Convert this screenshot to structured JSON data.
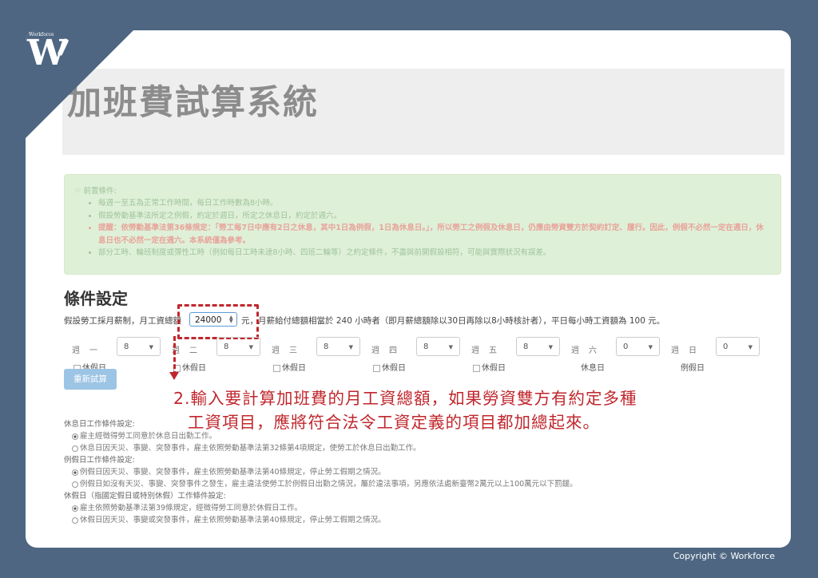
{
  "brand": {
    "logo_small": "Workforce",
    "logo_letter": "W"
  },
  "page_title": "加班費試算系統",
  "alert": {
    "heading": "前置條件:",
    "items": [
      {
        "text": "每週一至五為正常工作時間，每日工作時數為8小時。",
        "warn": false
      },
      {
        "text": "假設勞動基準法所定之例假，約定於週日，所定之休息日，約定於週六。",
        "warn": false
      },
      {
        "text": "提醒：依勞動基準法第36條規定：「勞工每7日中應有2日之休息，其中1日為例假，1日為休息日。」，所以勞工之例假及休息日，仍應由勞資雙方於契約訂定、履行。因此，例假不必然一定在週日，休息日也不必然一定在週六。本系統僅為參考。",
        "warn": true
      },
      {
        "text": "部分工時、輪班制度或彈性工時（例如每日工時未達8小時、四班二輪等）之約定條件，不盡與前開假設相符，可能與實際狀況有誤差。",
        "warn": false
      }
    ]
  },
  "conditions": {
    "title": "條件設定",
    "salary_prefix": "假設勞工採月薪制，月工資總額",
    "salary_value": "24000",
    "salary_suffix": "元，月薪給付總額相當於 240 小時者（即月薪總額除以30日再除以8小時核計者），平日每小時工資額為 100 元。",
    "days": [
      {
        "label": "週一",
        "hours": "8",
        "check": "休假日"
      },
      {
        "label": "週二",
        "hours": "8",
        "check": "休假日"
      },
      {
        "label": "週三",
        "hours": "8",
        "check": "休假日"
      },
      {
        "label": "週四",
        "hours": "8",
        "check": "休假日"
      },
      {
        "label": "週五",
        "hours": "8",
        "check": "休假日"
      },
      {
        "label": "週六",
        "hours": "0",
        "rest": "休息日"
      },
      {
        "label": "週日",
        "hours": "0",
        "rest": "例假日"
      }
    ],
    "recalc_label": "重新試算"
  },
  "annotation": {
    "line1": "2.輸入要計算加班費的月工資總額，如果勞資雙方有約定多種",
    "line2": "工資項目，應將符合法令工資定義的項目都加總起來。"
  },
  "options": {
    "rest_title": "休息日工作條件設定:",
    "rest_opts": [
      "雇主經徵得勞工同意於休息日出勤工作。",
      "休息日因天災、事變、突發事件，雇主依照勞動基準法第32條第4項規定，使勞工於休息日出勤工作。"
    ],
    "regular_title": "例假日工作條件設定:",
    "regular_opts": [
      "例假日因天災、事變、突發事件，雇主依照勞動基準法第40條規定，停止勞工假期之情況。",
      "例假日如沒有天災、事變、突發事件之發生，雇主違法使勞工於例假日出勤之情況，屬於違法事項，另應依法處新臺幣2萬元以上100萬元以下罰鍰。"
    ],
    "holiday_title": "休假日（指國定假日或特別休假）工作條件設定:",
    "holiday_opts": [
      "雇主依照勞動基準法第39條規定，經徵得勞工同意於休假日工作。",
      "休假日因天災、事變或突發事件，雇主依照勞動基準法第40條規定，停止勞工假期之情況。"
    ]
  },
  "copyright": "Copyright © Workforce"
}
